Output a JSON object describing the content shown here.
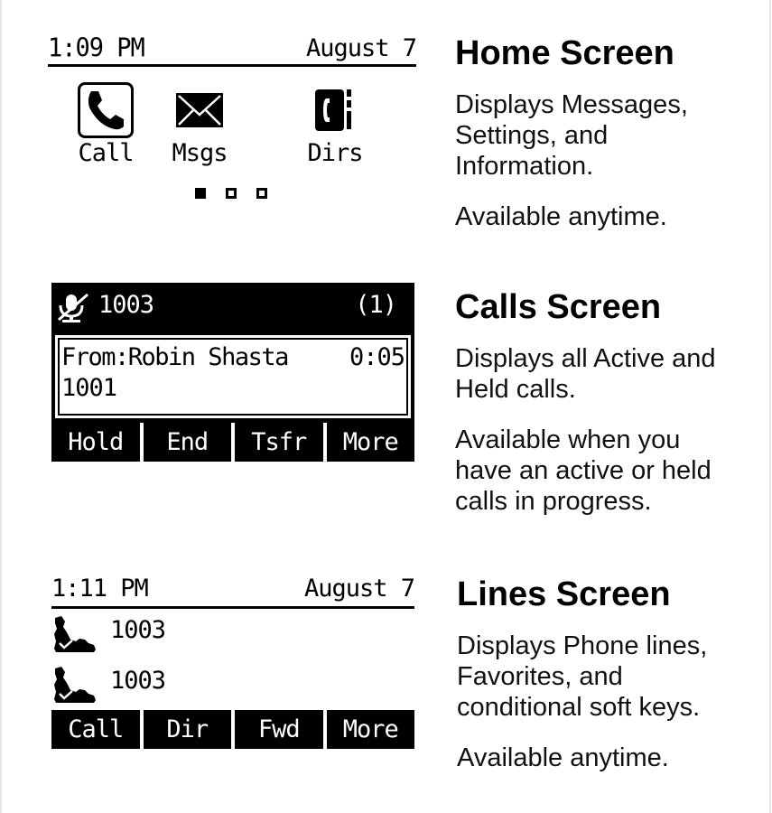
{
  "home_screen": {
    "status": {
      "time": "1:09 PM",
      "date": "August 7"
    },
    "icons": [
      {
        "label": "Call",
        "icon": "phone-handset-icon",
        "selected": true
      },
      {
        "label": "Msgs",
        "icon": "envelope-icon",
        "selected": false
      },
      {
        "label": "Dirs",
        "icon": "directory-book-icon",
        "selected": false
      }
    ],
    "page_indicator": {
      "pages": 3,
      "current": 1
    }
  },
  "calls_screen": {
    "header": {
      "icon": "mic-muted-icon",
      "line": "1003",
      "count": "(1)"
    },
    "call": {
      "from": "From:Robin Shasta",
      "duration": "0:05",
      "number": "1001"
    },
    "softkeys": [
      "Hold",
      "End",
      "Tsfr",
      "More"
    ]
  },
  "lines_screen": {
    "status": {
      "time": "1:11 PM",
      "date": "August 7"
    },
    "lines": [
      {
        "icon": "registered-line-icon",
        "extension": "1003"
      },
      {
        "icon": "registered-line-icon",
        "extension": "1003"
      }
    ],
    "softkeys": [
      "Call",
      "Dir",
      "Fwd",
      "More"
    ]
  },
  "descriptions": [
    {
      "title": "Home Screen",
      "text": "Displays Messages, Settings, and Information.",
      "availability": "Available anytime."
    },
    {
      "title": "Calls Screen",
      "text": "Displays all Active and Held calls.",
      "availability": "Available when you have an active or held calls in progress."
    },
    {
      "title": "Lines Screen",
      "text": "Displays Phone lines, Favorites, and conditional soft keys.",
      "availability": "Available anytime."
    }
  ]
}
